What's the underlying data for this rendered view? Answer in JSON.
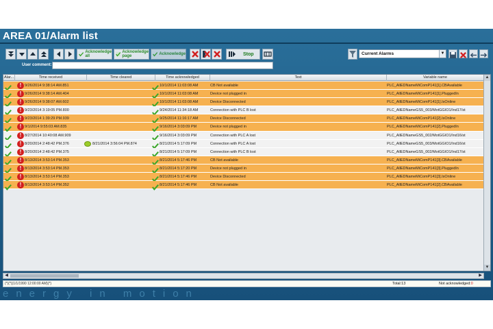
{
  "window": {
    "title": "AREA 01/Alarm list"
  },
  "toolbar": {
    "acknowledge_all": "Acknowledge\nall",
    "acknowledge_page": "Acknowledge\npage",
    "acknowledge": "Acknowledge",
    "stop": "Stop",
    "user_comment_label": "User comment:",
    "user_comment_value": ""
  },
  "filter": {
    "selected": "Current Alarms"
  },
  "columns": [
    "Alar...",
    "Time received",
    "Time cleared",
    "Time acknowledged",
    "Text",
    "Variable name"
  ],
  "rows": [
    {
      "state": "unack",
      "received": "9/26/2014 9:38:14 AM.851",
      "cleared": "",
      "acknowledged": "10/1/2014 11:03:08 AM",
      "text": "CB Not available",
      "variable": "PLC_AllEDNameMiComP141[1].CBAvailable"
    },
    {
      "state": "unack",
      "received": "9/26/2014 9:38:14 AM.404",
      "cleared": "",
      "acknowledged": "10/1/2014 11:03:08 AM",
      "text": "Device not plugged in",
      "variable": "PLC_AllEDNameMiComP141[1].PluggedIn"
    },
    {
      "state": "unack",
      "received": "9/26/2014 9:38:07 AM.602",
      "cleared": "",
      "acknowledged": "10/1/2014 11:03:08 AM",
      "text": "Device Disconnected",
      "variable": "PLC_AllEDNameMiComP141[1].IsOnline"
    },
    {
      "state": "ack",
      "received": "9/23/2014 3:19:05 PM.800",
      "cleared": "",
      "acknowledged": "9/24/2014 11:34:18 AM",
      "text": "Connection with PLC B lost",
      "variable": "PLC_AllEDNameGS5_003/MotGGIO1/Ind17/st"
    },
    {
      "state": "unack",
      "received": "9/23/2014 1:39:29 PM.939",
      "cleared": "",
      "acknowledged": "9/25/2014 11:16:17 AM",
      "text": "Device Disconnected",
      "variable": "PLC_AllEDNameMiComP141[2].IsOnline"
    },
    {
      "state": "unack",
      "received": "9/1/2014 9:55:03 AM.835",
      "cleared": "",
      "acknowledged": "9/16/2014 3:03:09 PM",
      "text": "Device not plugged in",
      "variable": "PLC_AllEDNameMiComP141[2].PluggedIn"
    },
    {
      "state": "ack",
      "received": "8/27/2014 10:40:08 AM.909",
      "cleared": "",
      "acknowledged": "9/16/2014 3:03:09 PM",
      "text": "Connection with PLC A lost",
      "variable": "PLC_AllEDNameGS5_002/MotGGIO1/Ind16/st"
    },
    {
      "state": "ack",
      "received": "8/20/2014 2:48:42 PM.376",
      "cleared": "8/21/2014 3:56:04 PM.874",
      "acknowledged": "8/21/2014 5:17:09 PM",
      "text": "Connection with PLC A lost",
      "variable": "PLC_AllEDNameGS5_003/MotGGIO1/Ind16/st"
    },
    {
      "state": "ack",
      "received": "8/20/2014 2:48:42 PM.375",
      "cleared": "",
      "acknowledged": "8/21/2014 5:17:09 PM",
      "text": "Connection with PLC B lost",
      "variable": "PLC_AllEDNameGS5_002/MotGGIO1/Ind17/st"
    },
    {
      "state": "unack",
      "received": "8/13/2014 3:53:14 PM.353",
      "cleared": "",
      "acknowledged": "8/21/2014 5:17:46 PM",
      "text": "CB Not available",
      "variable": "PLC_AllEDNameMiComP141[3].CBAvailable"
    },
    {
      "state": "unack",
      "received": "8/13/2014 3:53:14 PM.353",
      "cleared": "",
      "acknowledged": "8/21/2014 5:17:20 PM",
      "text": "Device not plugged in",
      "variable": "PLC_AllEDNameMiComP141[3].PluggedIn"
    },
    {
      "state": "unack",
      "received": "8/13/2014 3:53:14 PM.353",
      "cleared": "",
      "acknowledged": "8/21/2014 5:17:46 PM",
      "text": "Device Disconnected",
      "variable": "PLC_AllEDNameMiComP141[3].IsOnline"
    },
    {
      "state": "unack",
      "received": "8/13/2014 3:53:14 PM.352",
      "cleared": "",
      "acknowledged": "8/21/2014 5:17:46 PM",
      "text": "CB Not available",
      "variable": "PLC_AllEDNameMiComP141[2].CBAvailable"
    }
  ],
  "status": {
    "filter_text": "(*)(*)(1/1/1990 12:00:00 AM)(*)",
    "total": "Total:13",
    "not_ack_label": "Not acknowledged:",
    "not_ack_count": "0"
  },
  "tagline": "energy in motion",
  "colors": {
    "unack_row": "#f6b150",
    "ack_row": "#f2f2f2",
    "header_bg": "#1d5c86",
    "alarm_red": "#d21f1f",
    "ack_green": "#3aa62a"
  }
}
